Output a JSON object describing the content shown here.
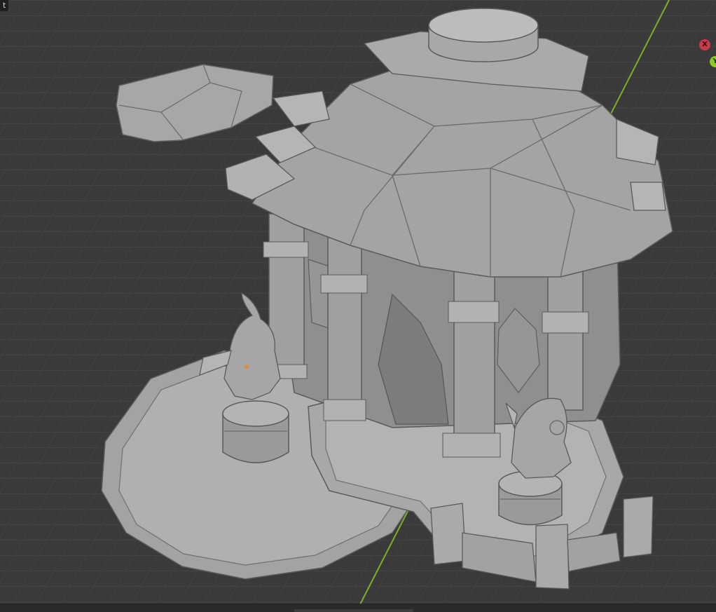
{
  "app": {
    "corner_label": "t"
  },
  "viewport": {
    "background_color": "#3a3a3a",
    "grid_color": "#4a4a4a",
    "y_axis_line_color": "#7fae2a",
    "model_color": "#9a9a9a"
  },
  "gizmo": {
    "x_label": "X",
    "x_color": "#c93a4a",
    "y_label": "Y",
    "y_color": "#8ccc1f"
  },
  "icons": [
    "navigation-gizmo-x-icon",
    "navigation-gizmo-y-icon"
  ]
}
